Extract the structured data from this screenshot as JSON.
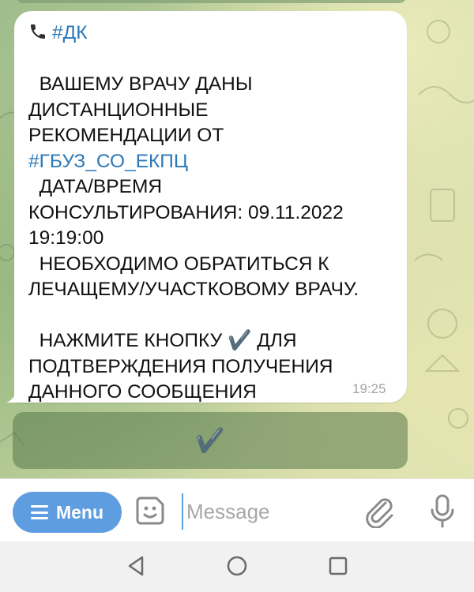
{
  "message": {
    "lines": [
      {
        "prefix": "",
        "text": "#ДК",
        "hashtag": true,
        "phone_icon": true
      },
      {
        "prefix": "",
        "text": ""
      },
      {
        "prefix": "",
        "text": "  ВАШЕМУ ВРАЧУ ДАНЫ"
      },
      {
        "prefix": "",
        "text": "ДИСТАНЦИОННЫЕ"
      },
      {
        "prefix": "",
        "text": "РЕКОМЕНДАЦИИ ОТ"
      },
      {
        "prefix": "",
        "text": "#ГБУЗ_СО_ЕКПЦ",
        "hashtag": true
      },
      {
        "prefix": "",
        "text": "  ДАТА/ВРЕМЯ"
      },
      {
        "prefix": "",
        "text": "КОНСУЛЬТИРОВАНИЯ: 09.11.2022"
      },
      {
        "prefix": "",
        "text": "19:19:00"
      },
      {
        "prefix": "",
        "text": "  НЕОБХОДИМО ОБРАТИТЬСЯ К"
      },
      {
        "prefix": "",
        "text": "ЛЕЧАЩЕМУ/УЧАСТКОВОМУ ВРАЧУ."
      },
      {
        "prefix": "",
        "text": ""
      },
      {
        "prefix": "",
        "text": "  НАЖМИТЕ КНОПКУ ✔️ ДЛЯ"
      },
      {
        "prefix": "",
        "text": "ПОДТВЕРЖДЕНИЯ ПОЛУЧЕНИЯ"
      },
      {
        "prefix": "",
        "text": "ДАННОГО СООБЩЕНИЯ"
      }
    ],
    "time": "19:25"
  },
  "inline_button": {
    "label": "✔️"
  },
  "composer": {
    "menu_label": "Menu",
    "placeholder": "Message"
  },
  "icons": {
    "phone": "phone-icon",
    "menu": "menu-bars-icon",
    "sticker": "sticker-icon",
    "attach": "paperclip-icon",
    "mic": "microphone-icon",
    "back": "back-triangle-icon",
    "home": "home-circle-icon",
    "recents": "recents-square-icon"
  },
  "colors": {
    "accent": "#5e9ee0",
    "hashtag": "#2b78b8",
    "time": "#a3a3a3"
  }
}
